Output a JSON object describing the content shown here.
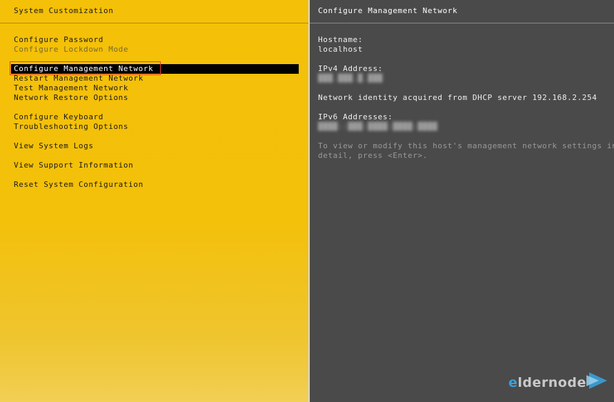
{
  "left": {
    "header_title": "System Customization",
    "menu": [
      {
        "label": "Configure Password"
      },
      {
        "label": "Configure Lockdown Mode"
      },
      {
        "label": "Configure Management Network"
      },
      {
        "label": "Restart Management Network"
      },
      {
        "label": "Test Management Network"
      },
      {
        "label": "Network Restore Options"
      },
      {
        "label": "Configure Keyboard"
      },
      {
        "label": "Troubleshooting Options"
      },
      {
        "label": "View System Logs"
      },
      {
        "label": "View Support Information"
      },
      {
        "label": "Reset System Configuration"
      }
    ]
  },
  "right": {
    "header_title": "Configure Management Network",
    "hostname_label": "Hostname:",
    "hostname_value": "localhost",
    "ipv4_label": "IPv4 Address:",
    "dhcp_text": "Network identity acquired from DHCP server 192.168.2.254",
    "ipv6_label": "IPv6 Addresses:",
    "hint_line1": "To view or modify this host's management network settings in",
    "hint_line2": "detail, press <Enter>."
  },
  "watermark": {
    "text_e": "e",
    "text_rest": "ldernode",
    "colors": {
      "accent": "#3aa0d8",
      "text": "#c9c9c9"
    }
  },
  "colors": {
    "left_panel": "#f4c008",
    "right_panel": "#4a4a4a",
    "selection": "#000000",
    "annotation_box": "#e8402a"
  }
}
